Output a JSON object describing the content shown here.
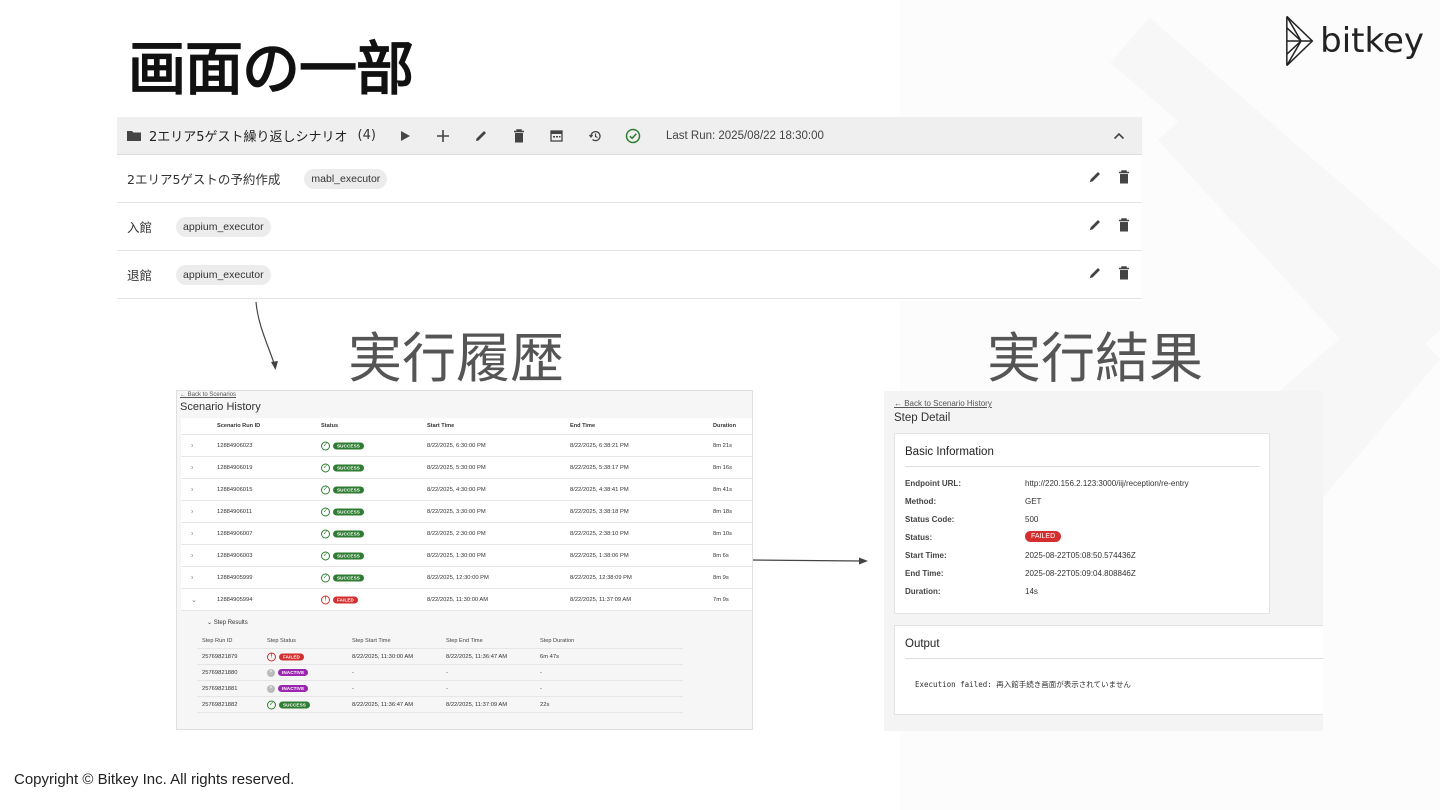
{
  "slide": {
    "title": "画面の一部",
    "logo_text": "bitkey",
    "copyright": "Copyright © Bitkey Inc. All rights reserved."
  },
  "scenario": {
    "name": "2エリア5ゲスト繰り返しシナリオ",
    "count": "(4)",
    "last_run": "Last Run: 2025/08/22 18:30:00",
    "header_icons": [
      "folder-icon",
      "play-icon",
      "add-icon",
      "edit-icon",
      "delete-icon",
      "calendar-icon",
      "history-icon",
      "check-circle-icon",
      "chevron-up-icon"
    ],
    "steps": [
      {
        "name": "2エリア5ゲストの予約作成",
        "executor": "mabl_executor"
      },
      {
        "name": "入館",
        "executor": "appium_executor"
      },
      {
        "name": "退館",
        "executor": "appium_executor"
      }
    ]
  },
  "labels": {
    "history": "実行履歴",
    "result": "実行結果"
  },
  "history": {
    "back_link": "← Back to Scenarios",
    "title": "Scenario History",
    "columns": [
      "Scenario Run ID",
      "Status",
      "Start Time",
      "End Time",
      "Duration"
    ],
    "rows": [
      {
        "id": "12884906023",
        "status": "SUCCESS",
        "start": "8/22/2025, 6:30:00 PM",
        "end": "8/22/2025, 6:38:21 PM",
        "duration": "8m 21s"
      },
      {
        "id": "12884906019",
        "status": "SUCCESS",
        "start": "8/22/2025, 5:30:00 PM",
        "end": "8/22/2025, 5:38:17 PM",
        "duration": "8m 16s"
      },
      {
        "id": "12884906015",
        "status": "SUCCESS",
        "start": "8/22/2025, 4:30:00 PM",
        "end": "8/22/2025, 4:38:41 PM",
        "duration": "8m 41s"
      },
      {
        "id": "12884906011",
        "status": "SUCCESS",
        "start": "8/22/2025, 3:30:00 PM",
        "end": "8/22/2025, 3:38:18 PM",
        "duration": "8m 18s"
      },
      {
        "id": "12884906007",
        "status": "SUCCESS",
        "start": "8/22/2025, 2:30:00 PM",
        "end": "8/22/2025, 2:38:10 PM",
        "duration": "8m 10s"
      },
      {
        "id": "12884906003",
        "status": "SUCCESS",
        "start": "8/22/2025, 1:30:00 PM",
        "end": "8/22/2025, 1:38:06 PM",
        "duration": "8m 6s"
      },
      {
        "id": "12884905999",
        "status": "SUCCESS",
        "start": "8/22/2025, 12:30:00 PM",
        "end": "8/22/2025, 12:38:09 PM",
        "duration": "8m 9s"
      },
      {
        "id": "12884905994",
        "status": "FAILED",
        "start": "8/22/2025, 11:30:00 AM",
        "end": "8/22/2025, 11:37:09 AM",
        "duration": "7m 9s"
      }
    ],
    "step_results": {
      "title": "Step Results",
      "columns": [
        "Step Run ID",
        "Step Status",
        "Step Start Time",
        "Step End Time",
        "Step Duration"
      ],
      "rows": [
        {
          "id": "25769821879",
          "status": "FAILED",
          "start": "8/22/2025, 11:30:00 AM",
          "end": "8/22/2025, 11:36:47 AM",
          "duration": "6m 47s"
        },
        {
          "id": "25769821880",
          "status": "INACTIVE",
          "start": "-",
          "end": "-",
          "duration": "-"
        },
        {
          "id": "25769821881",
          "status": "INACTIVE",
          "start": "-",
          "end": "-",
          "duration": "-"
        },
        {
          "id": "25769821882",
          "status": "SUCCESS",
          "start": "8/22/2025, 11:36:47 AM",
          "end": "8/22/2025, 11:37:09 AM",
          "duration": "22s"
        }
      ]
    }
  },
  "detail": {
    "back_link": "← Back to Scenario History",
    "title": "Step Detail",
    "basic_title": "Basic Information",
    "fields": [
      {
        "key": "Endpoint URL:",
        "value": "http://220.156.2.123:3000/iij/reception/re-entry"
      },
      {
        "key": "Method:",
        "value": "GET"
      },
      {
        "key": "Status Code:",
        "value": "500"
      },
      {
        "key": "Status:",
        "value": "FAILED",
        "badge": true
      },
      {
        "key": "Start Time:",
        "value": "2025-08-22T05:08:50.574436Z"
      },
      {
        "key": "End Time:",
        "value": "2025-08-22T05:09:04.808846Z"
      },
      {
        "key": "Duration:",
        "value": "14s"
      }
    ],
    "output_title": "Output",
    "output_text": "Execution failed: 再入館手続き画面が表示されていません"
  },
  "colors": {
    "success": "#2e7d32",
    "failed": "#d32f2f",
    "inactive": "#9c27b0"
  }
}
